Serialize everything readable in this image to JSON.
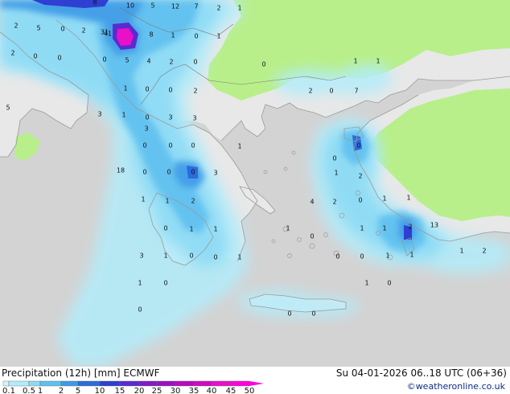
{
  "header": {
    "title": "Precipitation (12h) [mm] ECMWF",
    "valid_time": "Su 04-01-2026 06..18 UTC (06+36)",
    "credit": "©weatheronline.co.uk"
  },
  "colors": {
    "sea": "#d3d3d3",
    "land": "#e8e8e8",
    "dry_land": "#b8ef8a",
    "coast": "#9a9a9a",
    "border": "#7a7a7a"
  },
  "legend": {
    "ticks": [
      "0.1",
      "0.5",
      "1",
      "2",
      "5",
      "10",
      "15",
      "20",
      "25",
      "30",
      "35",
      "40",
      "45",
      "50"
    ],
    "colors": [
      "#d2f4ff",
      "#b2ecfa",
      "#8cdaf5",
      "#5ec0ef",
      "#3d9ae6",
      "#2c6bdc",
      "#2e3fd2",
      "#5a2bcf",
      "#7d1cc8",
      "#9b10c2",
      "#b60bbe",
      "#d00ac2",
      "#e810c8",
      "#ff00dc"
    ]
  },
  "map_labels": [
    "8",
    "10",
    "5",
    "12",
    "7",
    "2",
    "1",
    "2",
    "5",
    "0",
    "2",
    "31",
    "41",
    "8",
    "1",
    "0",
    "1",
    "2",
    "0",
    "0",
    "5",
    "4",
    "2",
    "0",
    "0",
    "0",
    "1",
    "1",
    "1",
    "0",
    "0",
    "2",
    "2",
    "0",
    "7",
    "5",
    "3",
    "1",
    "0",
    "3",
    "3",
    "3",
    "0",
    "0",
    "0",
    "1",
    "0",
    "18",
    "0",
    "0",
    "0",
    "3",
    "0",
    "1",
    "1",
    "2",
    "1",
    "2",
    "4",
    "2",
    "0",
    "1",
    "1",
    "0",
    "1",
    "1",
    "1",
    "0",
    "1",
    "1",
    "2",
    "13",
    "3",
    "1",
    "0",
    "0",
    "1",
    "0",
    "0",
    "1",
    "1",
    "1",
    "2",
    "1",
    "0",
    "1",
    "0",
    "0",
    "0",
    "0"
  ]
}
